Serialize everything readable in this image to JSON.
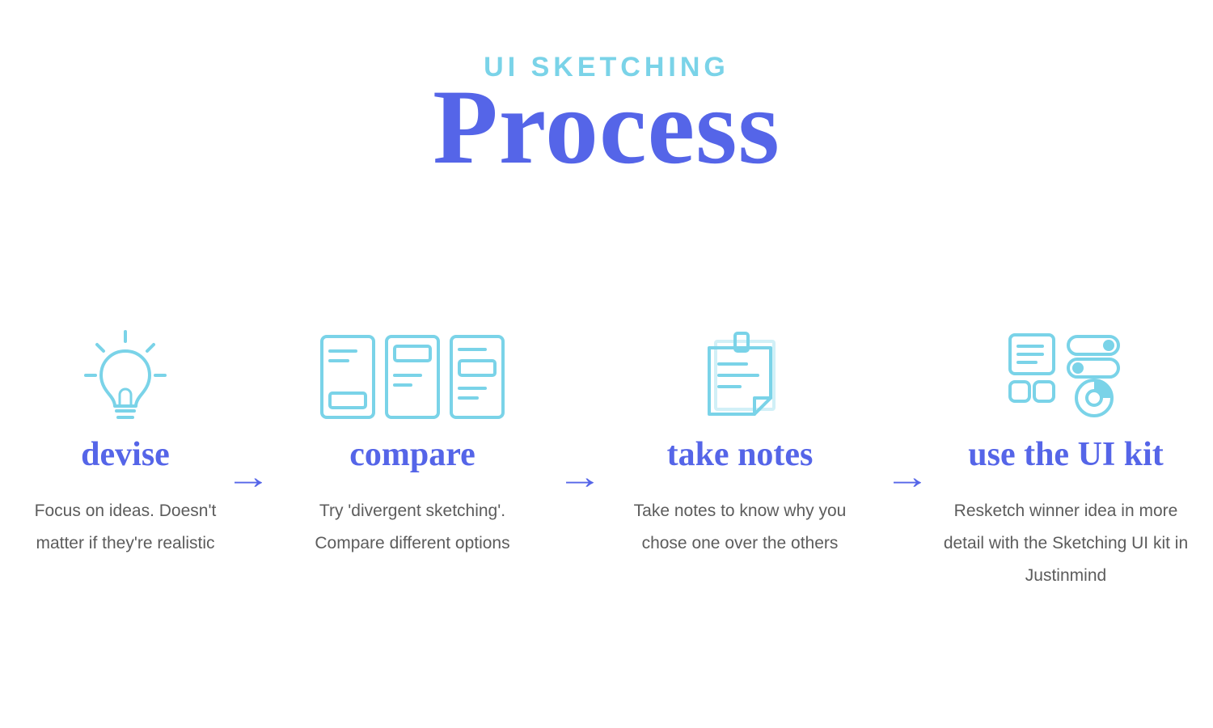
{
  "header": {
    "subtitle": "UI SKETCHING",
    "title": "Process"
  },
  "icon_color": "#7ad3e8",
  "arrow_glyph": "→",
  "steps": [
    {
      "icon": "lightbulb-icon",
      "title": "devise",
      "desc": "Focus on ideas. Doesn't matter if they're realistic"
    },
    {
      "icon": "layouts-icon",
      "title": "compare",
      "desc": "Try 'divergent sketching'. Compare different options"
    },
    {
      "icon": "sticky-note-icon",
      "title": "take notes",
      "desc": "Take notes to know why you chose one over the others"
    },
    {
      "icon": "ui-kit-icon",
      "title": "use the UI kit",
      "desc": "Resketch winner idea in more detail with the Sketching UI kit in Justinmind"
    }
  ]
}
